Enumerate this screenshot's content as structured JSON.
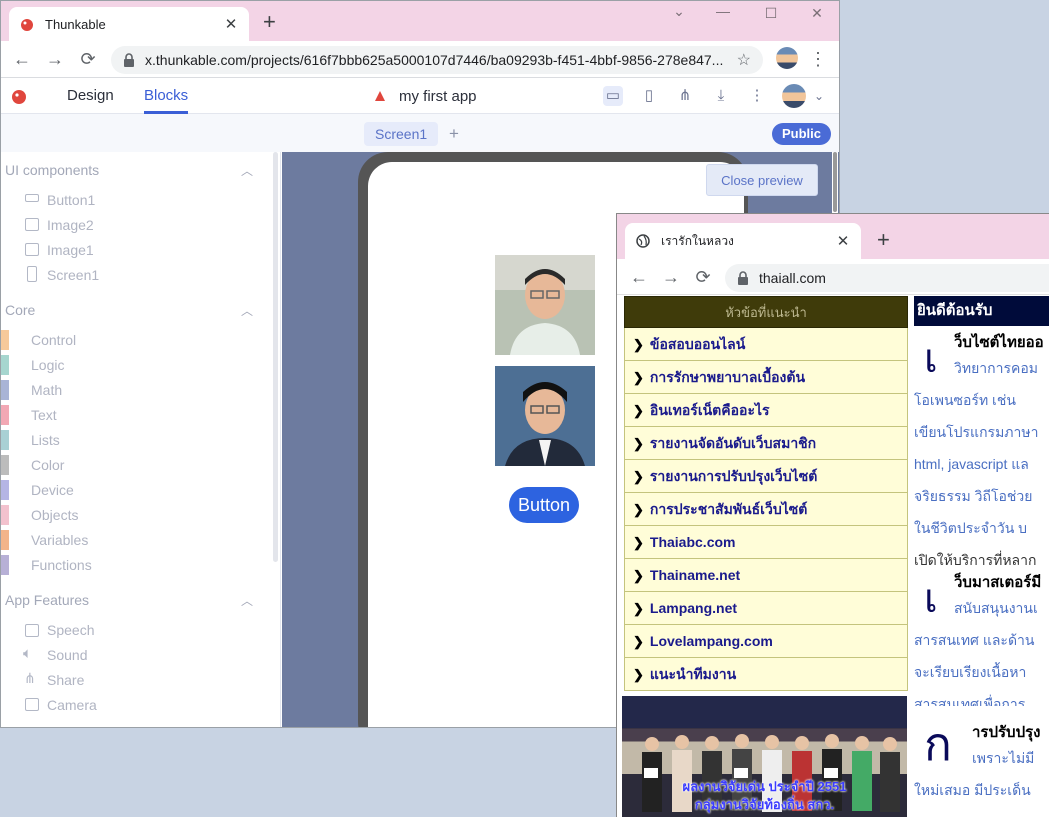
{
  "thunkable": {
    "tab_title": "Thunkable",
    "url": "x.thunkable.com/projects/616f7bbb625a5000107d7446/ba09293b-f451-4bbf-9856-278e847...",
    "app_tabs": {
      "design": "Design",
      "blocks": "Blocks"
    },
    "project_name": "my first app",
    "screen_tab": "Screen1",
    "add_screen": "+",
    "public_label": "Public",
    "sections": {
      "ui_components": {
        "title": "UI components",
        "items": [
          "Button1",
          "Image2",
          "Image1",
          "Screen1"
        ]
      },
      "core": {
        "title": "Core",
        "items": [
          {
            "label": "Control",
            "color": "#f6c99a"
          },
          {
            "label": "Logic",
            "color": "#a6d6cf"
          },
          {
            "label": "Math",
            "color": "#a9b4d6"
          },
          {
            "label": "Text",
            "color": "#f2a8b4"
          },
          {
            "label": "Lists",
            "color": "#a9d0d4"
          },
          {
            "label": "Color",
            "color": "#bcbcbc"
          },
          {
            "label": "Device",
            "color": "#b5b5e4"
          },
          {
            "label": "Objects",
            "color": "#f3c2ce"
          },
          {
            "label": "Variables",
            "color": "#f3b48a"
          },
          {
            "label": "Functions",
            "color": "#b7b0d6"
          }
        ]
      },
      "app_features": {
        "title": "App Features",
        "items": [
          "Speech",
          "Sound",
          "Share",
          "Camera"
        ]
      }
    },
    "preview": {
      "button_label": "Button",
      "close_preview": "Close preview"
    }
  },
  "thaiall": {
    "tab_title": "เรารักในหลวง",
    "url": "thaiall.com",
    "menu_header": "หัวข้อที่แนะนำ",
    "menu_items": [
      "ข้อสอบออนไลน์",
      "การรักษาพยาบาลเบื้องต้น",
      "อินเทอร์เน็ตคืออะไร",
      "รายงานจัดอันดับเว็บสมาชิก",
      "รายงานการปรับปรุงเว็บไซต์",
      "การประชาสัมพันธ์เว็บไซต์",
      "Thaiabc.com",
      "Thainame.net",
      "Lampang.net",
      "Lovelampang.com",
      "แนะนำทีมงาน"
    ],
    "promo_caption_1": "ผลงานวิจัยเด่น ประจำปี 2551",
    "promo_caption_2": "กลุ่มงานวิจัยท้องถิ่น สกว.",
    "welcome": "ยินดีต้อนรับ",
    "articles": [
      {
        "dropcap": "เ",
        "heading": "ว็บไซต์ไทยออ",
        "lines": [
          "วิทยาการคอม",
          "โอเพนซอร์ท เช่น",
          "เขียนโปรแกรมภาษา",
          "html, javascript แล",
          "จริยธรรม วิถีโอช่วย",
          "ในชีวิตประจำวัน บ",
          "เปิดให้บริการที่หลาก"
        ]
      },
      {
        "dropcap": "เ",
        "heading": "ว็บมาสเตอร์มี",
        "lines": [
          "สนับสนุนงานเ",
          "สารสนเทศ และด้าน",
          "จะเรียบเรียงเนื้อหา",
          "สารสนเทศเพื่อการ"
        ]
      },
      {
        "dropcap": "ก",
        "heading": "ารปรับปรุง",
        "lines": [
          "เพราะไม่มี",
          "ใหม่เสมอ มีประเด็น"
        ]
      }
    ]
  }
}
